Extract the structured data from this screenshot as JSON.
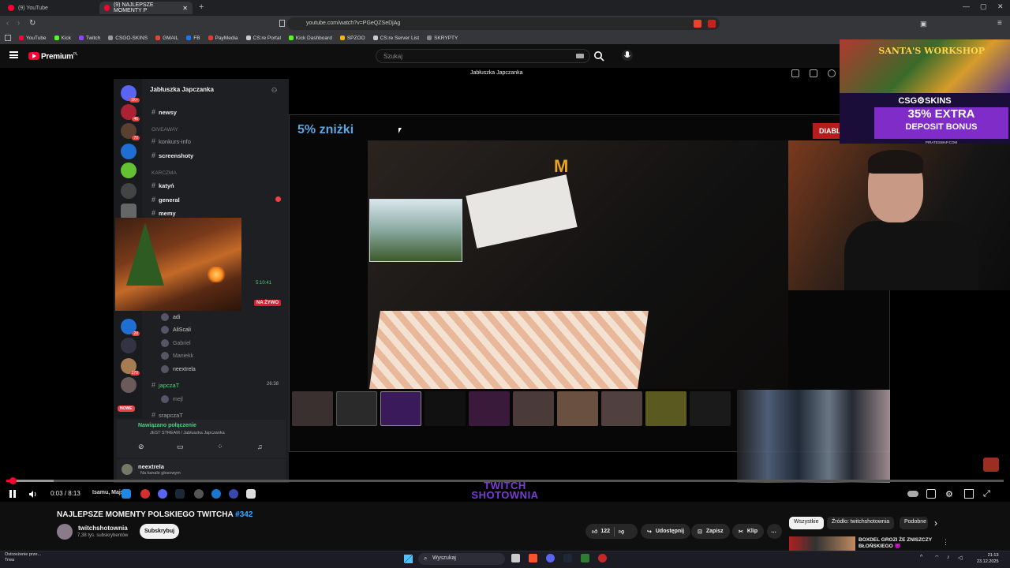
{
  "browser": {
    "tabs": [
      {
        "label": "(9) YouTube"
      },
      {
        "label": "(9) NAJLEPSZE MOMENTY P"
      }
    ],
    "url": "youtube.com/watch?v=PGeQZSeDjAg",
    "bookmarks": [
      "YouTube",
      "Kick",
      "Twitch",
      "CSGO-SKINS",
      "GMAIL",
      "FB",
      "PayMedia",
      "CS:re Portal",
      "Kick Dashboard",
      "SPZOO",
      "CS:re Server List",
      "SKRYPTY"
    ]
  },
  "youtube": {
    "brand": "Premium",
    "brand_sup": "PL",
    "search_placeholder": "Szukaj"
  },
  "stream": {
    "channel_label": "Jabłuszka Japczanka",
    "discount_text": "5% zniżki",
    "diables_text": "DIABLES",
    "watermark_line1": "TWITCH",
    "watermark_line2": "SHOTOWNIA",
    "colors": {
      "accent": "#7b3bd8",
      "discount": "#5aa7e6"
    }
  },
  "ad": {
    "title": "SANTA'S WORKSHOP",
    "brand": "CSG⚙SKINS",
    "promo_line1": "35% EXTRA",
    "promo_line2": "DEPOSIT BONUS",
    "url": "PIRATESWAP.COM"
  },
  "discord": {
    "server_name": "Jabłuszka Japczanka",
    "categories": {
      "giveaway": "GIVEAWAY",
      "karczma": "KARCZMA"
    },
    "channels": {
      "newsy": "newsy",
      "konkurs": "konkurs-info",
      "screenshoty": "screenshoty",
      "katyn": "katyń",
      "general": "general",
      "memy": "memy",
      "japczat": "japczaT",
      "srapczat": "srapczaT"
    },
    "live_badge": "NA ŻYWO",
    "stream_time": "5:10:41",
    "voice_time": "26:38",
    "members": [
      "adi",
      "AliScali",
      "Gabriel",
      "Maniekk",
      "neextrela",
      "mejl"
    ],
    "nowe_badge": "NOWE",
    "voice_status": "Nawiązano połączenie",
    "voice_sub": "JEST STREAM / Jabłuszka Japczanka",
    "user_name": "neextrela",
    "user_status": "Na kanale głosowym"
  },
  "player": {
    "time_current": "0:03",
    "time_total": "8:13",
    "time_display": "0:03 / 8:13",
    "chapter": "Isamu, Majszi",
    "progress_fraction": 0.006
  },
  "video": {
    "title": "NAJLEPSZE MOMENTY POLSKIEGO TWITCHA",
    "title_tag": "#342",
    "channel": "twitchshotownia",
    "subscribers": "7,38 tys. subskrybentów",
    "subscribe_label": "Subskrybuj",
    "likes": "122",
    "share_label": "Udostępnij",
    "save_label": "Zapisz",
    "clip_label": "Klip",
    "more_label": "…"
  },
  "sidebar_chips": [
    {
      "label": "Wszystkie",
      "active": true
    },
    {
      "label": "Źródło: twitchshotownia",
      "active": false
    },
    {
      "label": "Podobne",
      "active": false
    }
  ],
  "recommendation": {
    "title": "BOXDEL GROZI ŻE ZNISZCZY BŁOŃSKIEGO 😈"
  },
  "taskbar": {
    "weather_line1": "Ostrzeżenie prze...",
    "weather_line2": "Trwa",
    "search_label": "Wyszukaj",
    "time": "21:13",
    "date": "23.12.2025"
  }
}
